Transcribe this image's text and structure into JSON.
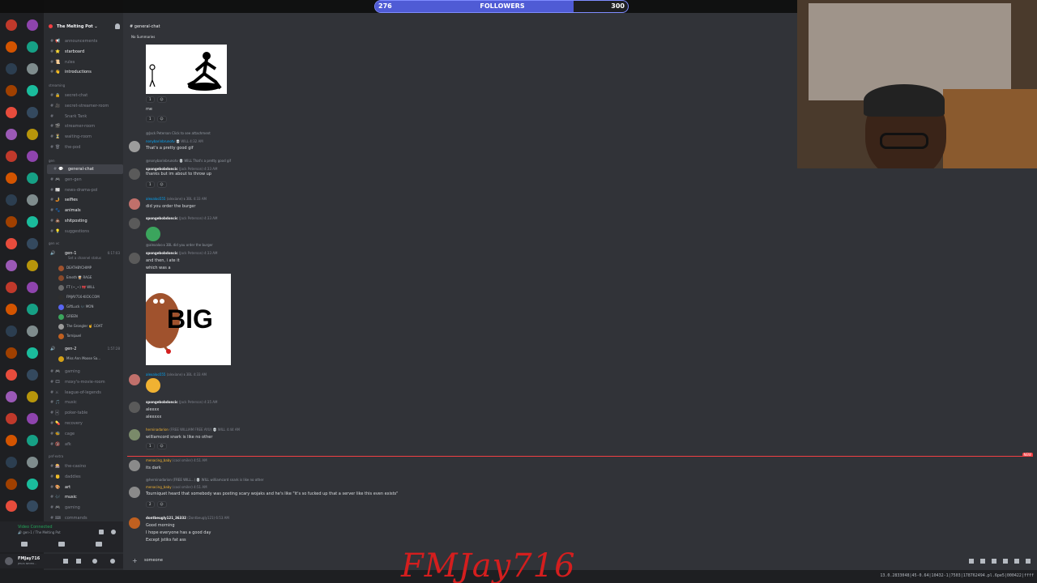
{
  "stream": {
    "followers_label": "FOLLOWERS",
    "followers_current": "276",
    "followers_goal": "300",
    "followers_progress": 0.78,
    "watermark": "FMJay716",
    "coords_readout": "13.0.2833048|45-0.64|10432-1|7503|178762494.pl.6pe5|000422|ffff"
  },
  "server": {
    "name": "The Melting Pot",
    "accent": "#f23f43"
  },
  "sidebar": {
    "channels_top": [
      {
        "emoji": "📢",
        "label": "announcements",
        "bold": false
      },
      {
        "emoji": "⭐",
        "label": "starboard",
        "bold": true
      },
      {
        "emoji": "📜",
        "label": "rules",
        "bold": false
      },
      {
        "emoji": "👋",
        "label": "introductions",
        "bold": true
      }
    ],
    "cat_streaming": "streaming",
    "channels_streaming": [
      {
        "emoji": "🔒",
        "label": "secret-chat",
        "bold": false
      },
      {
        "emoji": "🎥",
        "label": "secret-streamer-room",
        "bold": false
      },
      {
        "emoji": "",
        "label": "Snark Tank",
        "bold": false
      },
      {
        "emoji": "🎬",
        "label": "streamer-room",
        "bold": false
      },
      {
        "emoji": "⏳",
        "label": "waiting-room",
        "bold": false
      },
      {
        "emoji": "🗑",
        "label": "the-pod",
        "bold": false
      }
    ],
    "cat_gen": "gen",
    "channels_gen": [
      {
        "emoji": "💬",
        "label": "general-chat",
        "bold": true,
        "active": true
      },
      {
        "emoji": "🎮",
        "label": "gen-gen",
        "bold": false
      },
      {
        "emoji": "📰",
        "label": "news-drama-pol",
        "bold": false
      },
      {
        "emoji": "🤳",
        "label": "selfies",
        "bold": true
      },
      {
        "emoji": "🐾",
        "label": "animals",
        "bold": true
      },
      {
        "emoji": "💩",
        "label": "shitposting",
        "bold": true
      },
      {
        "emoji": "💡",
        "label": "suggestions",
        "bold": false
      }
    ],
    "cat_vc": "gen vc",
    "voice_channel": {
      "label": "gen-1",
      "time": "6:17:03",
      "status": "Set a channel status"
    },
    "voice_users": [
      {
        "name": "DEATHBYCHIMP",
        "color": "#a0522d"
      },
      {
        "name": "Emeth 🥃 RAGE",
        "color": "#8a4a2a"
      },
      {
        "name": "FT (~_~) 🎀 WILL",
        "color": "#6b6b6b"
      },
      {
        "name": "FMJAY716-KICK.COM",
        "color": "#2e2e2e"
      },
      {
        "name": "GiftLuck 🎶 MON",
        "color": "#5865f2"
      },
      {
        "name": "GREEN",
        "color": "#3ba55d"
      },
      {
        "name": "The Grongler 🤘 GOAT",
        "color": "#9c9c9c"
      },
      {
        "name": "Tornipuel",
        "color": "#c06020"
      }
    ],
    "voice_channel_2": {
      "label": "gen-2",
      "time": "1:57:28"
    },
    "voice_users_2": [
      {
        "name": "Miss Ann Moose Sa...",
        "color": "#d4a017"
      }
    ],
    "channels_other": [
      {
        "emoji": "🎮",
        "label": "gaming",
        "bold": false
      },
      {
        "emoji": "🎞",
        "label": "moxy's-movie-room",
        "bold": false
      },
      {
        "emoji": "⚔",
        "label": "league-of-legends",
        "bold": false
      },
      {
        "emoji": "🎵",
        "label": "music",
        "bold": false
      },
      {
        "emoji": "🃏",
        "label": "poker-table",
        "bold": false
      },
      {
        "emoji": "💊",
        "label": "recovery",
        "bold": false
      },
      {
        "emoji": "🐝",
        "label": "cage",
        "bold": false
      },
      {
        "emoji": "🔞",
        "label": "afk",
        "bold": false
      }
    ],
    "cat_extra": "pnf-extra",
    "channels_extra": [
      {
        "emoji": "🎰",
        "label": "the-casino",
        "bold": false
      },
      {
        "emoji": "👶",
        "label": "daddies",
        "bold": false
      },
      {
        "emoji": "🎨",
        "label": "art",
        "bold": true
      },
      {
        "emoji": "🎶",
        "label": "music",
        "bold": true
      },
      {
        "emoji": "🎮",
        "label": "gaming",
        "bold": false
      },
      {
        "emoji": "⌨",
        "label": "commands",
        "bold": false
      }
    ],
    "voice_panel": {
      "status": "Video Connected",
      "sub": "🔊 gen-1 / The Melting Pot"
    },
    "user_panel": {
      "name": "FMJay716",
      "status": "JESUS NEVER..."
    }
  },
  "chat": {
    "channel": "general-chat",
    "summaries": "No Summaries",
    "messages": [
      {
        "text": "me"
      },
      {
        "reply": "@Jack Peterson  Click to see attachment",
        "user": "nonybarinbrunotv",
        "tag": "💀 WILL",
        "time": "4:32 AM",
        "text": "That's a pretty good gif"
      },
      {
        "reply": "@nonybarinbrunotv  💀 WILL  That's a pretty good gif",
        "user": "spongebobdoncic",
        "sub": "(Jack Peterson)",
        "time": "4:33 AM",
        "text": "thanks but im about to throw up"
      },
      {
        "user": "alexaloo555",
        "sub": "(alexiane)",
        "tag": "ℹ 3BL",
        "time": "4:33 AM",
        "text": "did you order the burger"
      },
      {
        "user": "spongebobdoncic",
        "sub": "(Jack Peterson)",
        "time": "4:33 AM",
        "text": ""
      },
      {
        "reply": "@alexaloo  ℹ 3BL  did you order the burger",
        "user": "spongebobdoncic",
        "sub": "(Jack Peterson)",
        "time": "4:33 AM",
        "text": "and then, i ate it",
        "text2": "which was a"
      },
      {
        "user": "alexaloo555",
        "sub": "(alexiane)",
        "tag": "ℹ 3BL",
        "time": "4:33 AM",
        "text": ""
      },
      {
        "user": "spongebobdoncic",
        "sub": "(Jack Peterson)",
        "time": "4:35 AM",
        "text": "alexxx",
        "text2": "alexxxx"
      },
      {
        "user": "herninadarion",
        "sub": "(FREE WILLIAM FREE AYU)",
        "tag": "💀 WILL",
        "time": "4:44 AM",
        "text": "williamcord snark is like no other"
      },
      {
        "user": "menacing_baby",
        "sub": "(cool smiler)",
        "time": "4:51 AM",
        "text": "its dark"
      },
      {
        "reply": "@herninadarion (FREE WILL...)  💀 WILL  williamcord snark is like no other",
        "user": "menacing_baby",
        "sub": "(cool smiler)",
        "time": "4:51 AM",
        "text": "Tourniquet heard that somebody was posting scary wojaks and he's like \"it's so fucked up that a server like this even exists\""
      },
      {
        "user": "dontbeugly121_36332",
        "sub": "(Dontbeugly121)",
        "time": "6:53 AM",
        "text": "Good morning",
        "text2": "I hope everyone has a good day",
        "text3": "Except jstiks fat ass"
      }
    ],
    "reaction_counts": [
      "1",
      "1",
      "1",
      "1",
      "2"
    ],
    "image_big_text": "BIG",
    "new_tag": "NEW",
    "composer": "someone"
  }
}
